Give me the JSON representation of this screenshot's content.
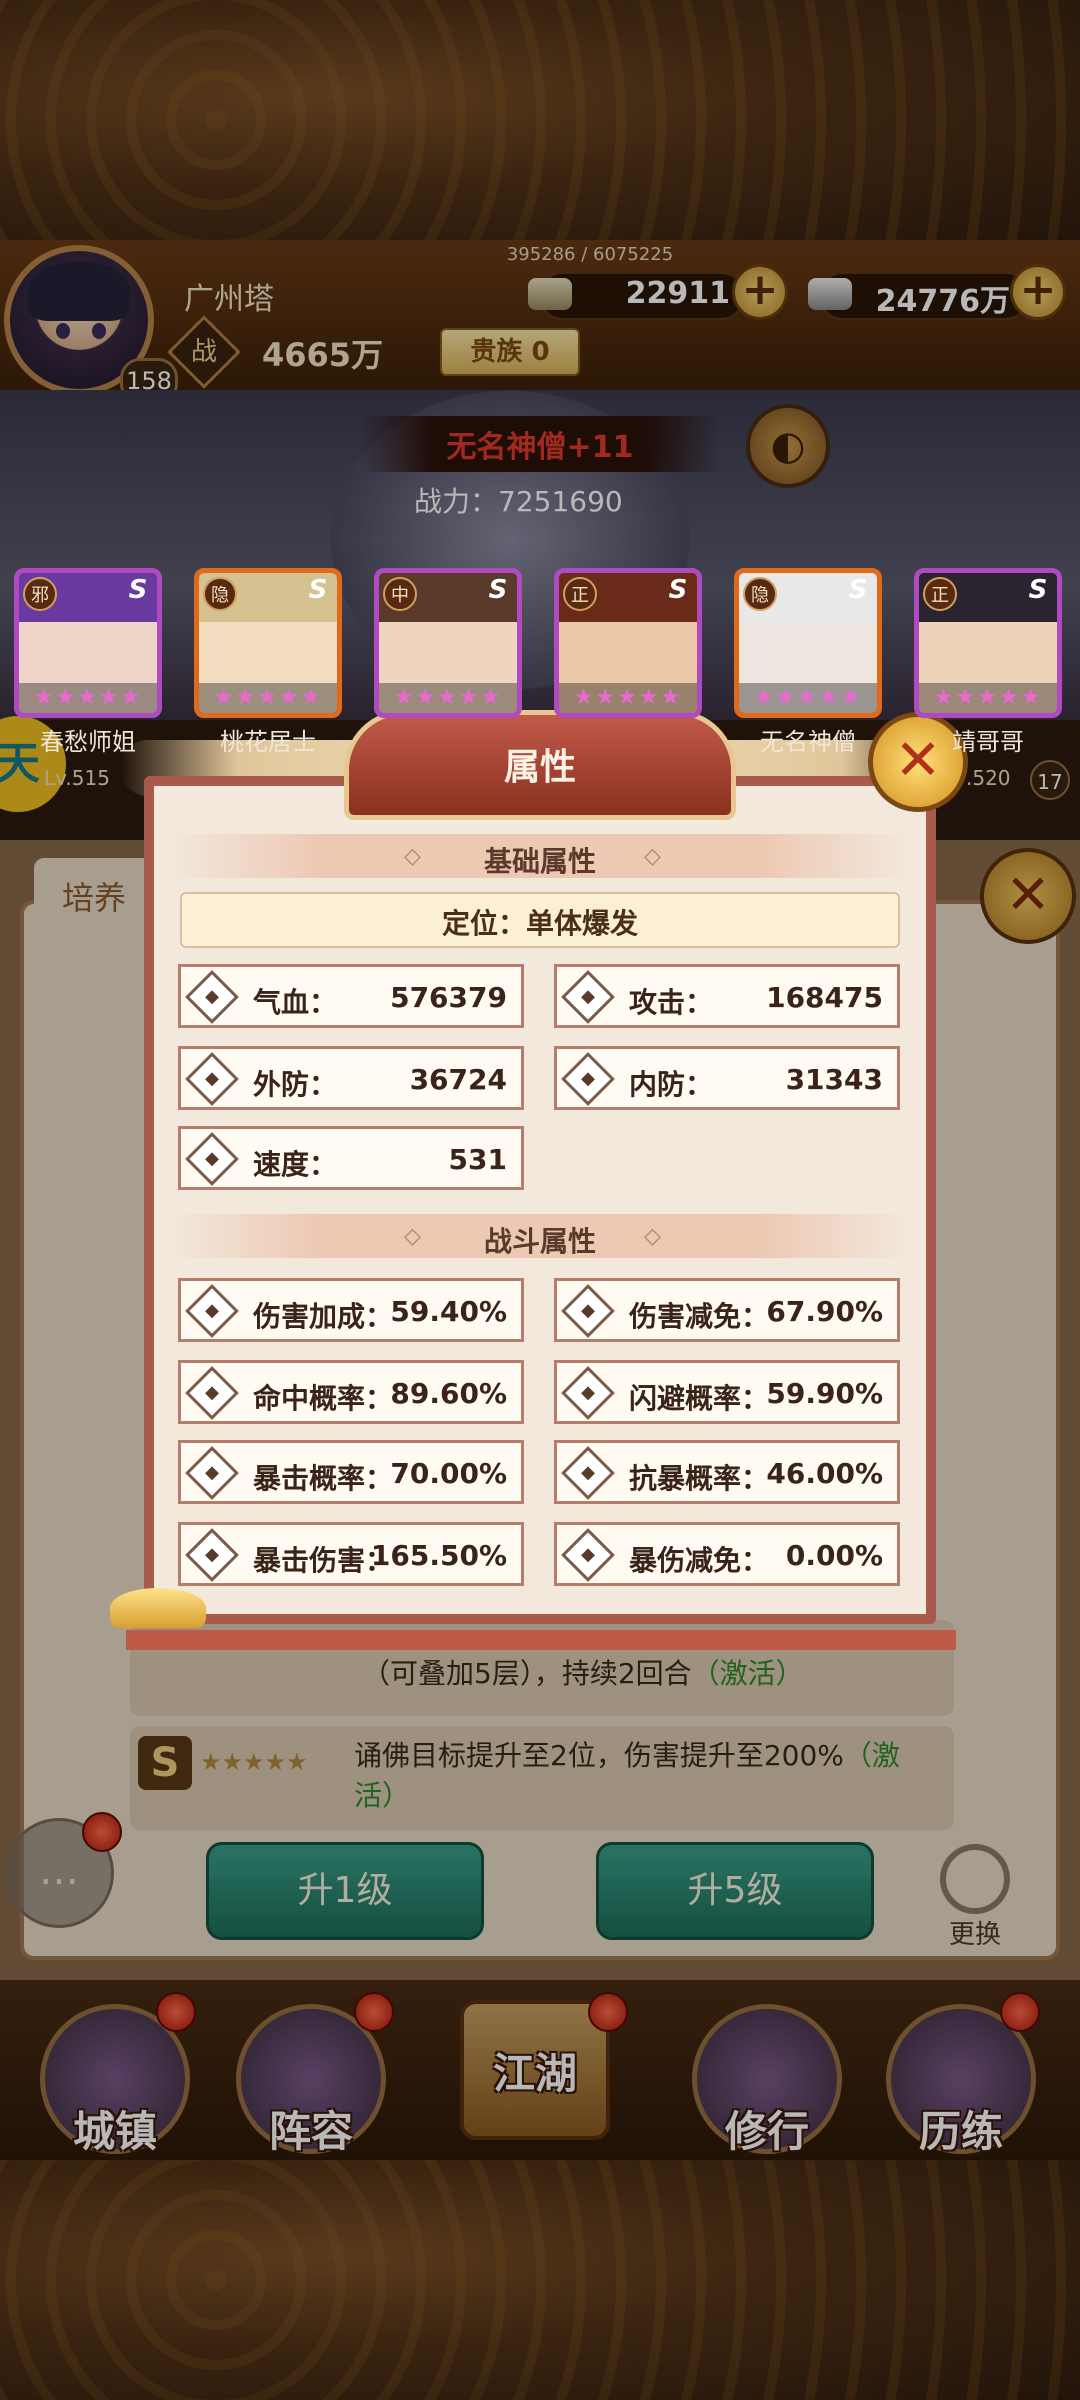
{
  "top_bar": {
    "player_level": "158",
    "exp": "395286 / 6075225",
    "player_name": "广州塔",
    "gold": "22911",
    "silver": "24776万",
    "power_icon_label": "战",
    "power": "4665万",
    "vip": "贵族 0"
  },
  "scene": {
    "boss_name": "无名神僧+11",
    "boss_power": "战力：7251690"
  },
  "heroes": [
    {
      "tag": "邪",
      "name": "春愁师姐",
      "border": "#b04ac0"
    },
    {
      "tag": "隐",
      "name": "桃花居士",
      "border": "#e06a1a"
    },
    {
      "tag": "中",
      "name": "",
      "border": "#b04ac0"
    },
    {
      "tag": "正",
      "name": "",
      "border": "#b04ac0"
    },
    {
      "tag": "隐",
      "name": "无名神僧",
      "border": "#e06a1a"
    },
    {
      "tag": "正",
      "name": "靖哥哥",
      "border": "#b04ac0"
    }
  ],
  "side": {
    "left_level": "Lv.515",
    "right_level": ".520",
    "right_count": "17"
  },
  "underlay": {
    "tab_label": "培养",
    "skill_text_1": "（可叠加5层），持续2回合",
    "skill_text_1_status": "（激活）",
    "skill_s_icon": "S",
    "skill_stars": "★★★★★",
    "skill_text_2": "诵佛目标提升至2位，伤害提升至200%",
    "skill_text_2_status": "（激活）",
    "btn_up1": "升1级",
    "btn_up5": "升5级",
    "change_label": "更换"
  },
  "modal": {
    "title": "属性",
    "basic_section": "基础属性",
    "role": "定位：单体爆发",
    "basic_stats": [
      {
        "icon": "heart-icon",
        "label": "气血：",
        "value": "576379"
      },
      {
        "icon": "sword-icon",
        "label": "攻击：",
        "value": "168475"
      },
      {
        "icon": "shield-icon",
        "label": "外防：",
        "value": "36724"
      },
      {
        "icon": "flame-icon",
        "label": "内防：",
        "value": "31343"
      },
      {
        "icon": "speed-icon",
        "label": "速度：",
        "value": "531"
      }
    ],
    "combat_section": "战斗属性",
    "combat_stats": [
      {
        "icon": "damage-up-icon",
        "label": "伤害加成：",
        "value": "59.40%"
      },
      {
        "icon": "skull-icon",
        "label": "伤害减免：",
        "value": "67.90%"
      },
      {
        "icon": "target-icon",
        "label": "命中概率：",
        "value": "89.60%"
      },
      {
        "icon": "dodge-icon",
        "label": "闪避概率：",
        "value": "59.90%"
      },
      {
        "icon": "crit-icon",
        "label": "暴击概率：",
        "value": "70.00%"
      },
      {
        "icon": "anti-crit-icon",
        "label": "抗暴概率：",
        "value": "46.00%"
      },
      {
        "icon": "crit-damage-icon",
        "label": "暴击伤害：",
        "value": "165.50%"
      },
      {
        "icon": "crit-reduce-icon",
        "label": "暴伤减免：",
        "value": "0.00%"
      }
    ]
  },
  "nav": {
    "town": "城镇",
    "lineup": "阵容",
    "jianghu": "江湖",
    "practice": "修行",
    "training": "历练"
  },
  "colors": {
    "modal_border": "#a85a4c",
    "button_green": "#2a8a72",
    "rank_purple": "#b04ac0",
    "rank_orange": "#e06a1a",
    "boss_name_red": "#e03a2a"
  }
}
